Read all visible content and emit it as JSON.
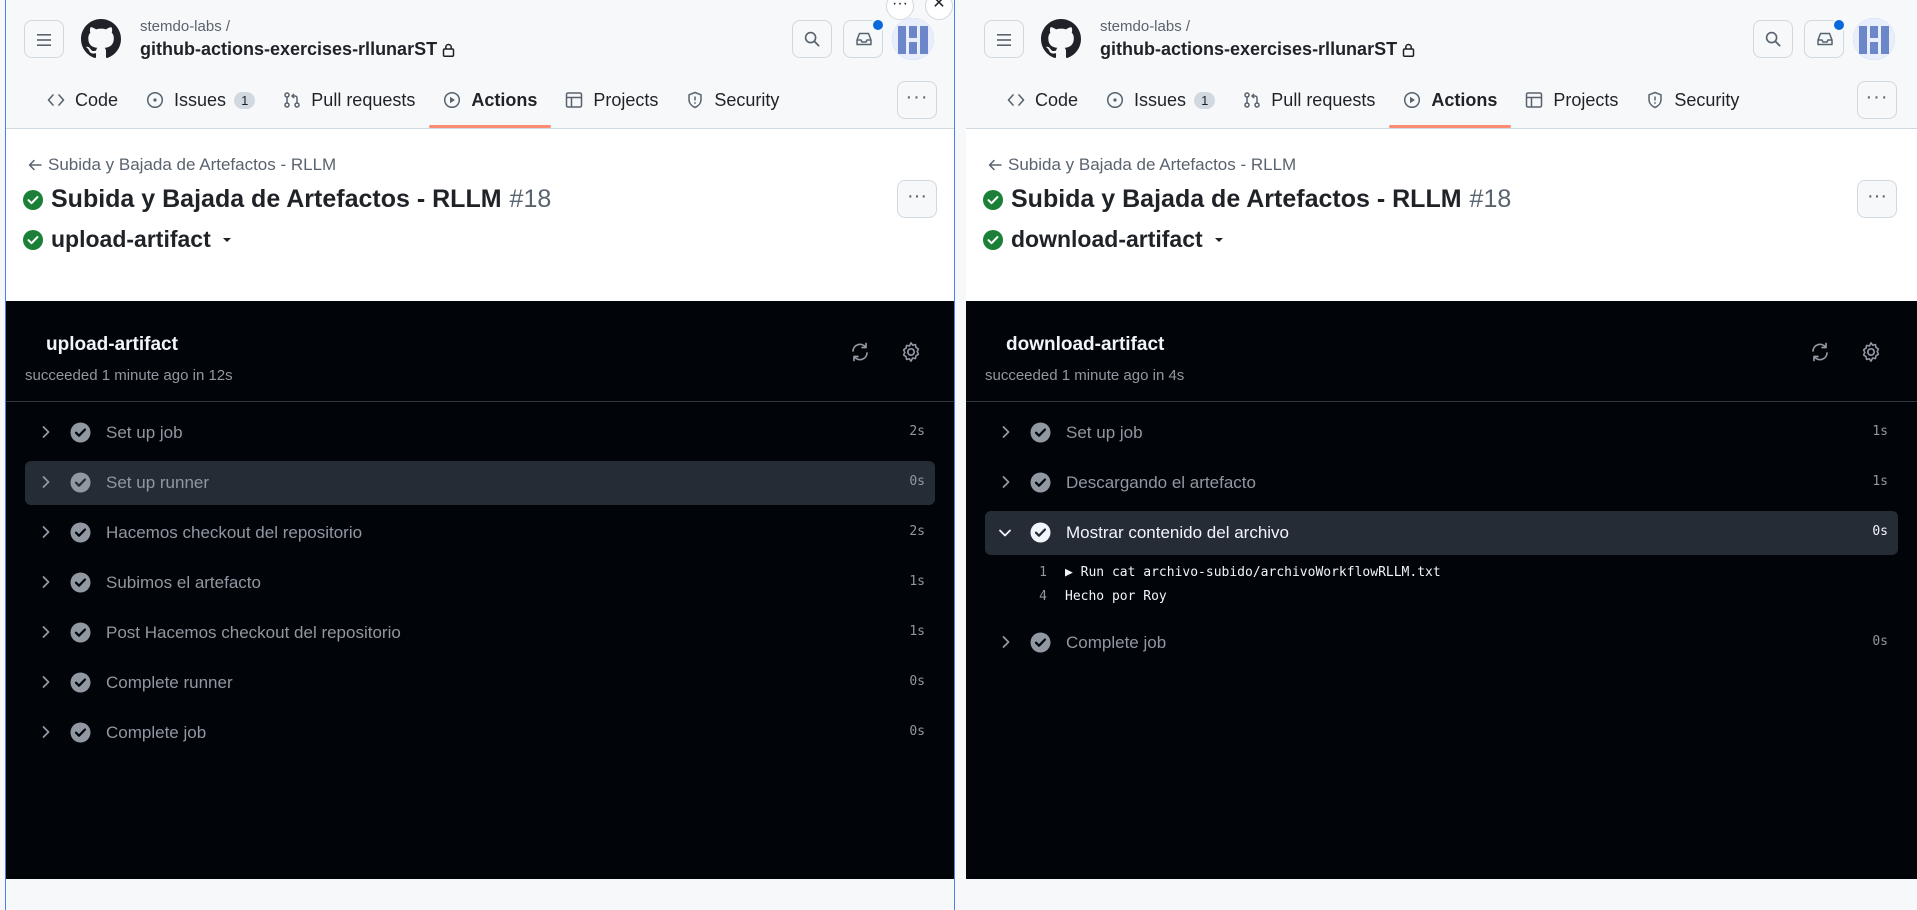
{
  "left": {
    "org": "stemdo-labs /",
    "repo": "github-actions-exercises-rllunarST",
    "tabs": [
      {
        "label": "Code"
      },
      {
        "label": "Issues",
        "count": "1"
      },
      {
        "label": "Pull requests"
      },
      {
        "label": "Actions"
      },
      {
        "label": "Projects"
      },
      {
        "label": "Security"
      }
    ],
    "back_link": "Subida y Bajada de Artefactos - RLLM",
    "run_title": "Subida y Bajada de Artefactos - RLLM",
    "run_number": "#18",
    "job_select": "upload-artifact",
    "log_job": "upload-artifact",
    "log_status": "succeeded 1 minute ago in 12s",
    "steps": [
      {
        "label": "Set up job",
        "dur": "2s"
      },
      {
        "label": "Set up runner",
        "dur": "0s"
      },
      {
        "label": "Hacemos checkout del repositorio",
        "dur": "2s"
      },
      {
        "label": "Subimos el artefacto",
        "dur": "1s"
      },
      {
        "label": "Post Hacemos checkout del repositorio",
        "dur": "1s"
      },
      {
        "label": "Complete runner",
        "dur": "0s"
      },
      {
        "label": "Complete job",
        "dur": "0s"
      }
    ]
  },
  "right": {
    "org": "stemdo-labs /",
    "repo": "github-actions-exercises-rllunarST",
    "tabs": [
      {
        "label": "Code"
      },
      {
        "label": "Issues",
        "count": "1"
      },
      {
        "label": "Pull requests"
      },
      {
        "label": "Actions"
      },
      {
        "label": "Projects"
      },
      {
        "label": "Security"
      }
    ],
    "back_link": "Subida y Bajada de Artefactos - RLLM",
    "run_title": "Subida y Bajada de Artefactos - RLLM",
    "run_number": "#18",
    "job_select": "download-artifact",
    "log_job": "download-artifact",
    "log_status": "succeeded 1 minute ago in 4s",
    "steps": [
      {
        "label": "Set up job",
        "dur": "1s"
      },
      {
        "label": "Descargando el artefacto",
        "dur": "1s"
      },
      {
        "label": "Mostrar contenido del archivo",
        "dur": "0s"
      },
      {
        "label": "Complete job",
        "dur": "0s"
      }
    ],
    "log_lines": [
      {
        "num": "1",
        "text": "▶ Run cat archivo-subido/archivoWorkflowRLLM.txt"
      },
      {
        "num": "4",
        "text": "Hecho por Roy"
      }
    ]
  },
  "floating": {
    "more": "···",
    "close": "✕"
  },
  "colors": {
    "success": "#1a7f37",
    "active_tab_underline": "#fd8c73",
    "log_bg": "#010409",
    "notif": "#0969da"
  }
}
